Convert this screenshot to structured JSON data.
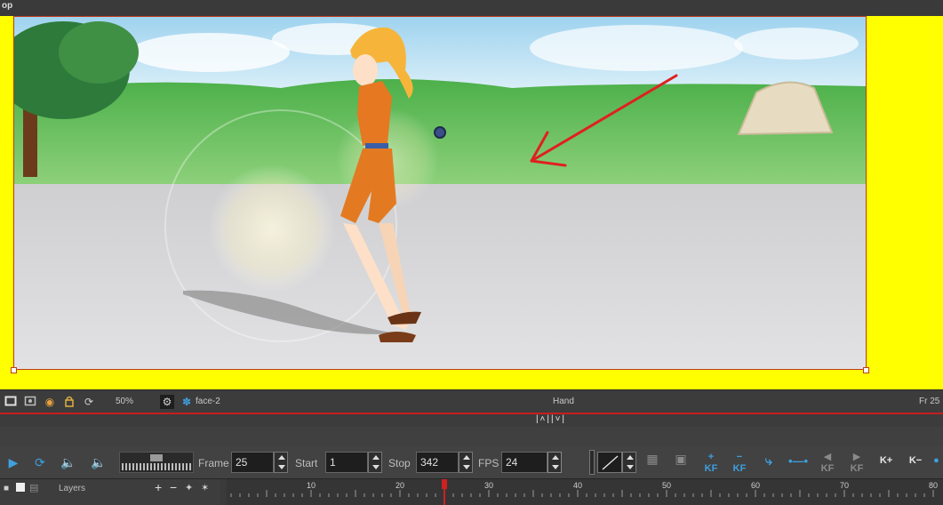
{
  "window": {
    "title_fragment": "op"
  },
  "view": {
    "zoom": "50%",
    "camera_name": "face-2",
    "tool_name": "Hand",
    "frame_indicator": "Fr 25"
  },
  "playback": {
    "frame_label": "Frame",
    "frame_value": "25",
    "start_label": "Start",
    "start_value": "1",
    "stop_label": "Stop",
    "stop_value": "342",
    "fps_label": "FPS",
    "fps_value": "24"
  },
  "key_buttons": {
    "add_kf": "KF",
    "remove_kf": "KF",
    "prev_kf": "KF",
    "next_kf": "KF",
    "k_plus": "K+",
    "k_minus": "K−"
  },
  "timeline": {
    "layers_label": "Layers",
    "ruler_ticks": [
      "10",
      "20",
      "30",
      "40",
      "50",
      "60",
      "70",
      "80"
    ],
    "current_frame": 25
  },
  "colors": {
    "stage_background": "#ffff00",
    "frame_border": "#c03a1a",
    "accent_blue": "#3da0e0",
    "playhead_red": "#d02020",
    "annotation_arrow": "#e02020"
  },
  "icons": {
    "record_mode": "square-icon",
    "camera_view": "camera-icon",
    "onion_skin": "onion-icon",
    "lock": "lock-icon",
    "reset_rotation": "rotate-icon",
    "settings": "gear-icon",
    "camera_selector": "cog-blue-icon",
    "play": "play-icon",
    "loop": "loop-icon",
    "sound": "speaker-icon",
    "sound_s": "speaker-s-icon"
  }
}
